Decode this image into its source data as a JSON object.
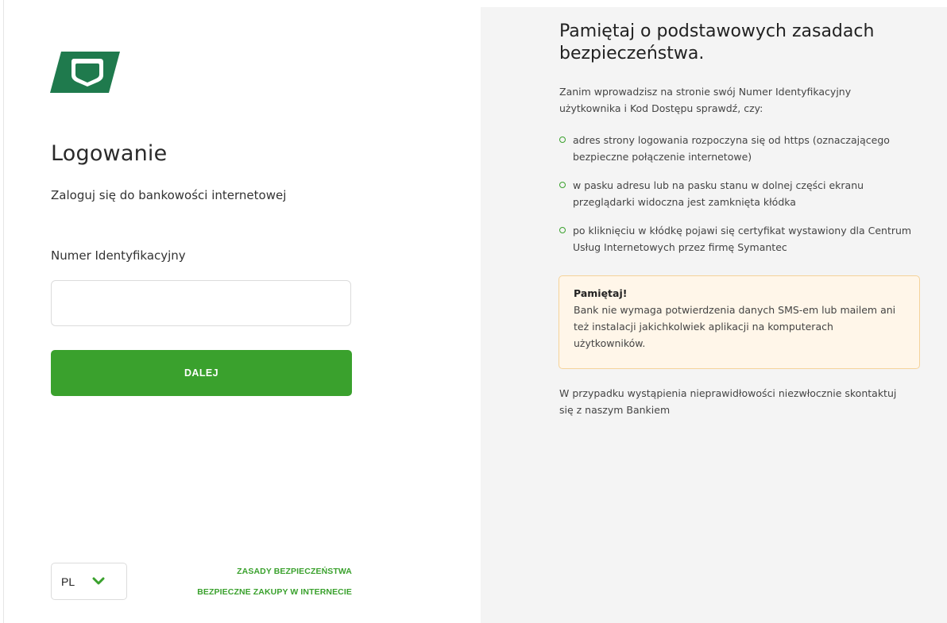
{
  "login": {
    "title": "Logowanie",
    "subtitle": "Zaloguj się do bankowości internetowej",
    "id_label": "Numer Identyfikacyjny",
    "id_value": "",
    "id_placeholder": "",
    "next_label": "DALEJ"
  },
  "footer": {
    "language": "PL",
    "links": [
      "ZASADY BEZPIECZEŃSTWA",
      "BEZPIECZNE ZAKUPY W INTERNECIE"
    ]
  },
  "security": {
    "title": "Pamiętaj o podstawowych zasadach bezpieczeństwa.",
    "intro": "Zanim wprowadzisz na stronie swój Numer Identyfikacyjny użytkownika i Kod Dostępu sprawdź, czy:",
    "checks": [
      "adres strony logowania rozpoczyna się od https (oznaczającego bezpieczne połączenie internetowe)",
      "w pasku adresu lub na pasku stanu w dolnej części ekranu przeglądarki widoczna jest zamknięta kłódka",
      "po kliknięciu w kłódkę pojawi się certyfikat wystawiony dla Centrum Usług Internetowych przez firmę Symantec"
    ],
    "notice_title": "Pamiętaj!",
    "notice_body": "Bank nie wymaga potwierdzenia danych SMS-em lub mailem ani też instalacji jakichkolwiek aplikacji na komputerach użytkowników.",
    "contact": "W przypadku wystąpienia nieprawidłowości niezwłocznie skontaktuj się z naszym Bankiem"
  },
  "colors": {
    "accent_green": "#3aa12d",
    "logo_green": "#1f7a4d",
    "notice_bg": "#fff6e9",
    "notice_border": "#f5d39a",
    "panel_bg": "#f4f4f4"
  },
  "icons": {
    "logo": "bank-logo-icon",
    "language_toggle": "chevron-down-icon",
    "list_bullet": "circle-bullet-icon"
  }
}
